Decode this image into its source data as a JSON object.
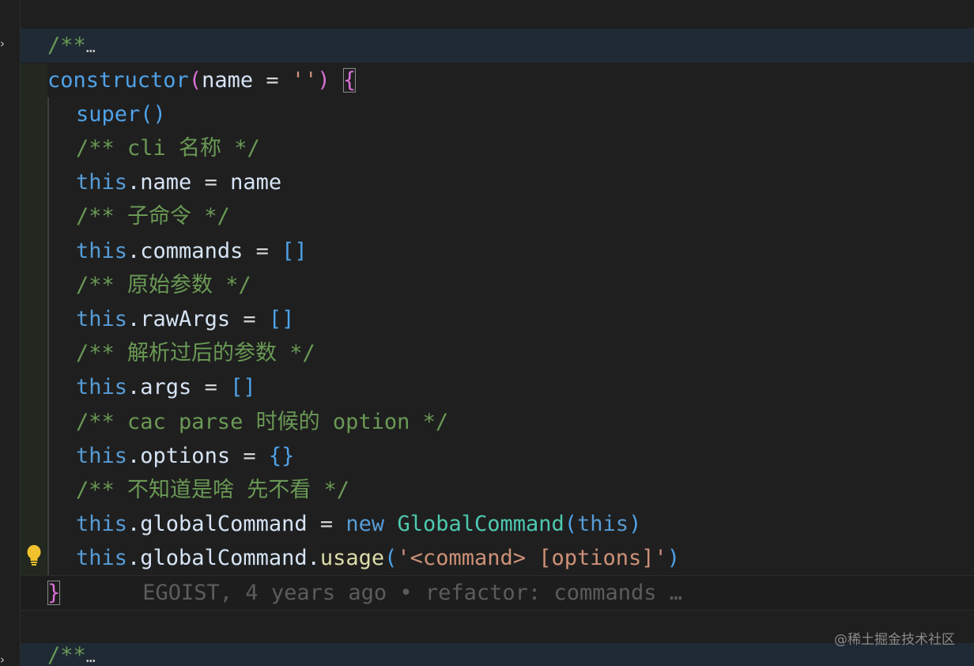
{
  "editor": {
    "folded_top": {
      "text": "/**",
      "ellipsis": "…"
    },
    "constructor_line": {
      "keyword": "constructor",
      "open_paren": "(",
      "param": "name",
      "equals": " = ",
      "default": "''",
      "close_paren": ")",
      "open_brace": "{"
    },
    "body": [
      {
        "kind": "call",
        "callee": "super",
        "args": "()"
      },
      {
        "kind": "comment",
        "text": "/** cli 名称 */"
      },
      {
        "kind": "assign",
        "this": "this",
        "prop": ".name",
        "op": " = ",
        "value": "name"
      },
      {
        "kind": "comment",
        "text": "/** 子命令 */"
      },
      {
        "kind": "assign",
        "this": "this",
        "prop": ".commands",
        "op": " = ",
        "value": "[]"
      },
      {
        "kind": "comment",
        "text": "/** 原始参数 */"
      },
      {
        "kind": "assign",
        "this": "this",
        "prop": ".rawArgs",
        "op": " = ",
        "value": "[]"
      },
      {
        "kind": "comment",
        "text": "/** 解析过后的参数 */"
      },
      {
        "kind": "assign",
        "this": "this",
        "prop": ".args",
        "op": " = ",
        "value": "[]"
      },
      {
        "kind": "comment",
        "text": "/** cac parse 时候的 option */"
      },
      {
        "kind": "assign",
        "this": "this",
        "prop": ".options",
        "op": " = ",
        "value": "{}"
      },
      {
        "kind": "comment",
        "text": "/** 不知道是啥 先不看 */"
      }
    ],
    "global_command_line": {
      "this": "this",
      "prop": ".globalCommand",
      "op": " = ",
      "new_kw": "new",
      "class_name": "GlobalCommand",
      "open_paren": "(",
      "arg": "this",
      "close_paren": ")"
    },
    "usage_line": {
      "this": "this",
      "prop": ".globalCommand.",
      "method": "usage",
      "open_paren": "(",
      "string": "'<command> [options]'",
      "close_paren": ")"
    },
    "closing_brace": "}",
    "blame": "EGOIST, 4 years ago • refactor: commands …",
    "folded_bottom": {
      "text": "/**",
      "ellipsis": "…"
    }
  },
  "icons": {
    "fold": "chevron-right-icon",
    "lightbulb": "lightbulb-icon"
  },
  "colors": {
    "background": "#1f1f1f",
    "keyword": "#569cd6",
    "comment": "#6a9955",
    "string": "#ce9178",
    "class": "#4ec9b0",
    "method": "#dcdcaa",
    "lightbulb": "#f2c12e"
  },
  "watermark": "@稀土掘金技术社区"
}
